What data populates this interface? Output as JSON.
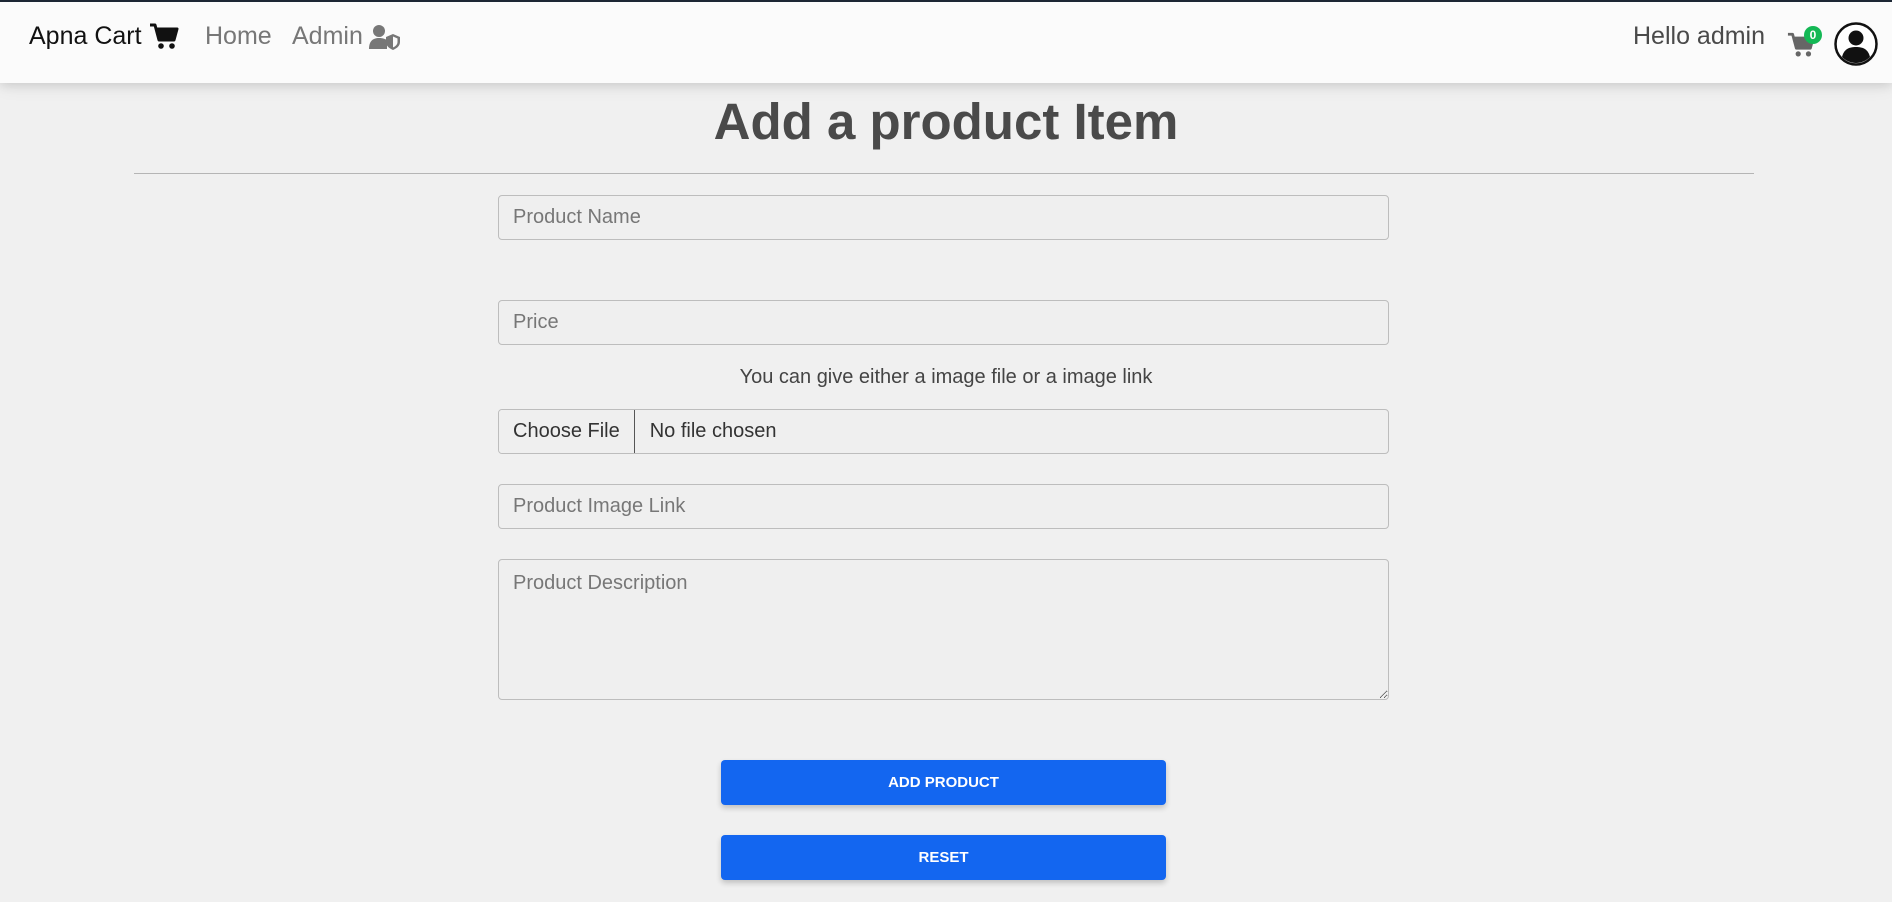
{
  "navbar": {
    "brand": "Apna Cart",
    "brand_icon": "cart-icon",
    "links": [
      {
        "label": "Home"
      },
      {
        "label": "Admin",
        "icon": "user-shield-icon"
      }
    ],
    "greeting": "Hello admin",
    "cart_count": "0",
    "badge_color": "#14b855",
    "avatar_icon": "user-circle-icon"
  },
  "form": {
    "title": "Add a product Item",
    "name_placeholder": "Product Name",
    "price_placeholder": "Price",
    "image_hint": "You can give either a image file or a image link",
    "file_button": "Choose File",
    "file_status": "No file chosen",
    "link_placeholder": "Product Image Link",
    "description_placeholder": "Product Description",
    "add_button": "ADD PRODUCT",
    "reset_button": "RESET",
    "accent_color": "#1366f0"
  }
}
